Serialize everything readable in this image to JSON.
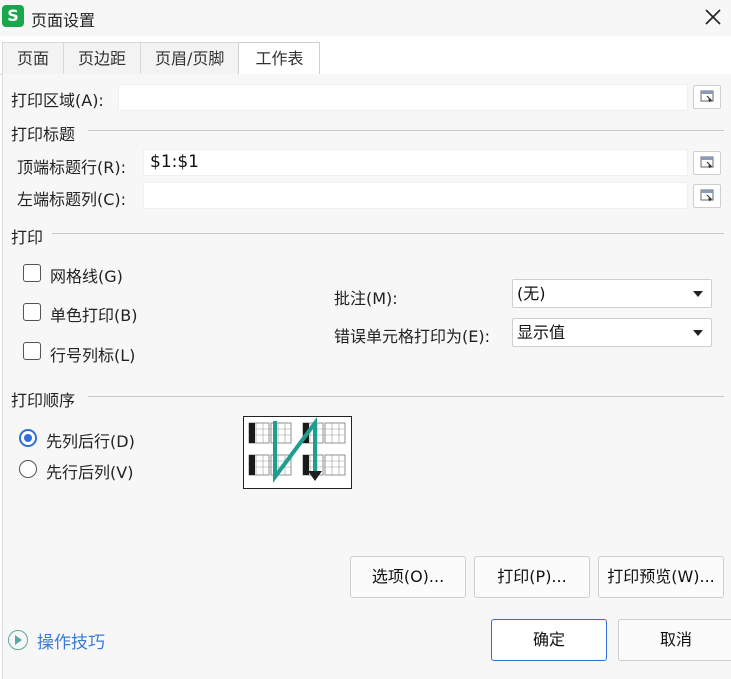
{
  "window": {
    "title": "页面设置",
    "app_icon_letter": "S"
  },
  "tabs": [
    {
      "label": "页面"
    },
    {
      "label": "页边距"
    },
    {
      "label": "页眉/页脚"
    },
    {
      "label": "工作表"
    }
  ],
  "print_area": {
    "label": "打印区域(A):",
    "value": ""
  },
  "print_titles": {
    "section": "打印标题",
    "top_rows": {
      "label": "顶端标题行(R):",
      "value": "$1:$1"
    },
    "left_cols": {
      "label": "左端标题列(C):",
      "value": ""
    }
  },
  "print": {
    "section": "打印",
    "gridlines": {
      "label": "网格线(G)",
      "checked": false
    },
    "mono": {
      "label": "单色打印(B)",
      "checked": false
    },
    "row_col_headers": {
      "label": "行号列标(L)",
      "checked": false
    },
    "comments": {
      "label": "批注(M):",
      "value": "(无)"
    },
    "errors": {
      "label": "错误单元格打印为(E):",
      "value": "显示值"
    }
  },
  "print_order": {
    "section": "打印顺序",
    "down_then_over": {
      "label": "先列后行(D)",
      "selected": true
    },
    "over_then_down": {
      "label": "先行后列(V)",
      "selected": false
    }
  },
  "buttons": {
    "options": "选项(O)...",
    "print": "打印(P)...",
    "preview": "打印预览(W)...",
    "ok": "确定",
    "cancel": "取消"
  },
  "tips": {
    "label": "操作技巧"
  },
  "colors": {
    "accent": "#2f6fd6",
    "app_green": "#1aa64a",
    "link": "#3a7bd5",
    "order_arrow": "#1f9e8f"
  }
}
